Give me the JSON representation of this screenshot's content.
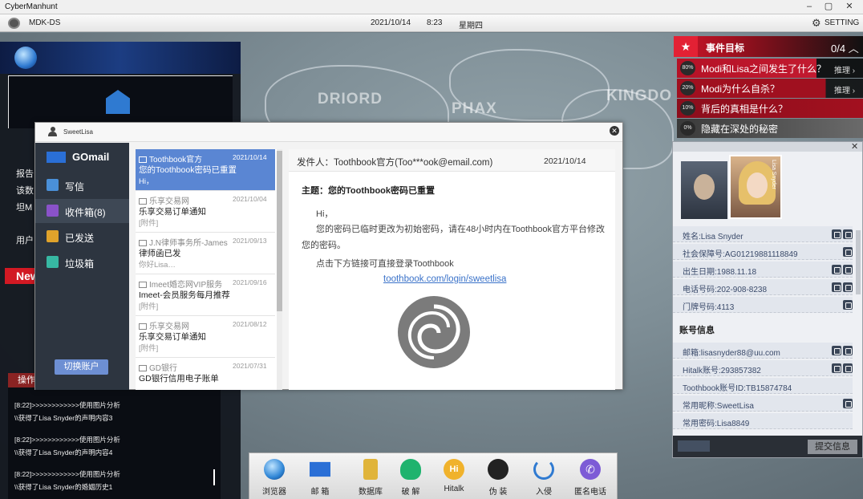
{
  "window": {
    "title": "CyberManhunt"
  },
  "topbar": {
    "app": "MDK-DS",
    "date": "2021/10/14",
    "time": "8:23",
    "weekday": "星期四",
    "setting": "SETTING"
  },
  "map": {
    "words": [
      "DRIORD",
      "PHAX",
      "KINGDO"
    ]
  },
  "left": {
    "fragments": [
      "报告",
      "该数",
      "坦M",
      "用户"
    ],
    "news": "New",
    "oplog_header": "操作",
    "log": [
      "[8:22]>>>>>>>>>>>>使用图片分析",
      "\\\\获得了Lisa Snyder的声明内容3",
      "[8:22]>>>>>>>>>>>>使用图片分析",
      "\\\\获得了Lisa Snyder的声明内容4",
      "[8:22]>>>>>>>>>>>>使用图片分析",
      "\\\\获得了Lisa Snyder的婚姻历史1"
    ]
  },
  "mail": {
    "account": "SweetLisa",
    "brand": "GOmail",
    "nav": [
      {
        "label": "写信",
        "color": "#4a90d9"
      },
      {
        "label": "收件箱(8)",
        "color": "#8a52c9"
      },
      {
        "label": "已发送",
        "color": "#e0a32b"
      },
      {
        "label": "垃圾箱",
        "color": "#37b8a3"
      }
    ],
    "switch_account": "切换账户",
    "list": [
      {
        "from": "Toothbook官方",
        "date": "2021/10/14",
        "subject": "您的Toothbook密码已重置",
        "preview": "Hi，"
      },
      {
        "from": "乐享交易网",
        "date": "2021/10/04",
        "subject": "乐享交易订单通知",
        "preview": "[附件]"
      },
      {
        "from": "J.N律师事务所-James",
        "date": "2021/09/13",
        "subject": "律师函已发",
        "preview": "你好Lisa…"
      },
      {
        "from": "Imeet婚恋网VIP服务",
        "date": "2021/09/16",
        "subject": "Imeet-会员服务每月推荐",
        "preview": "[附件]"
      },
      {
        "from": "乐享交易网",
        "date": "2021/08/12",
        "subject": "乐享交易订单通知",
        "preview": "[附件]"
      },
      {
        "from": "GD银行",
        "date": "2021/07/31",
        "subject": "GD银行信用电子账单",
        "preview": ""
      }
    ],
    "reader": {
      "from": "发件人：Toothbook官方(Too***ook@email.com)",
      "date": "2021/10/14",
      "subject": "主题：您的Toothbook密码已重置",
      "greeting": "Hi，",
      "body": "您的密码已临时更改为初始密码，请在48小时内在Toothbook官方平台修改您的密码。",
      "cta": "点击下方链接可直接登录Toothbook",
      "link": "toothbook.com/login/sweetlisa"
    }
  },
  "events": {
    "title": "事件目标",
    "count": "0/4",
    "hint": "推理",
    "items": [
      {
        "pct": "80%",
        "text": "Modi和Lisa之间发生了什么？",
        "color": "#b51226",
        "hint": true
      },
      {
        "pct": "20%",
        "text": "Modi为什么自杀？",
        "color": "#a0101f",
        "hint": true
      },
      {
        "pct": "10%",
        "text": "背后的真相是什么？",
        "color": "#8c0e1c",
        "hint": false
      },
      {
        "pct": "0%",
        "text": "隐藏在深处的秘密",
        "color": "#3a3a3a",
        "hint": false
      }
    ]
  },
  "profile": {
    "card_name": "Lisa Snyder",
    "personal": [
      {
        "text": "姓名:Lisa Snyder",
        "icons": 2
      },
      {
        "text": "社会保障号:AG01219881118849",
        "icons": 1
      },
      {
        "text": "出生日期:1988.11.18",
        "icons": 2
      },
      {
        "text": "电话号码:202-908-8238",
        "icons": 2
      },
      {
        "text": "门牌号码:4113",
        "icons": 1
      }
    ],
    "account_section": "账号信息",
    "accounts": [
      {
        "text": "邮箱:lisasnyder88@uu.com",
        "icons": 2
      },
      {
        "text": "Hitalk账号:293857382",
        "icons": 2
      },
      {
        "text": "Toothbook账号ID:TB15874784",
        "icons": 0
      },
      {
        "text": "常用昵称:SweetLisa",
        "icons": 1
      },
      {
        "text": "常用密码:Lisa8849",
        "icons": 0
      }
    ],
    "submit": "提交信息"
  },
  "taskbar": [
    {
      "label": "浏览器",
      "color": "#2f86d6"
    },
    {
      "label": "邮 箱",
      "color": "#2a6fd6"
    },
    {
      "label": "数据库",
      "color": "#e0b43a"
    },
    {
      "label": "破 解",
      "color": "#1fb36e"
    },
    {
      "label": "Hitalk",
      "color": "#f0b22c"
    },
    {
      "label": "伪 装",
      "color": "#222222"
    },
    {
      "label": "入侵",
      "color": "#2f7ad1"
    },
    {
      "label": "匿名电话",
      "color": "#7d5bd6"
    }
  ]
}
